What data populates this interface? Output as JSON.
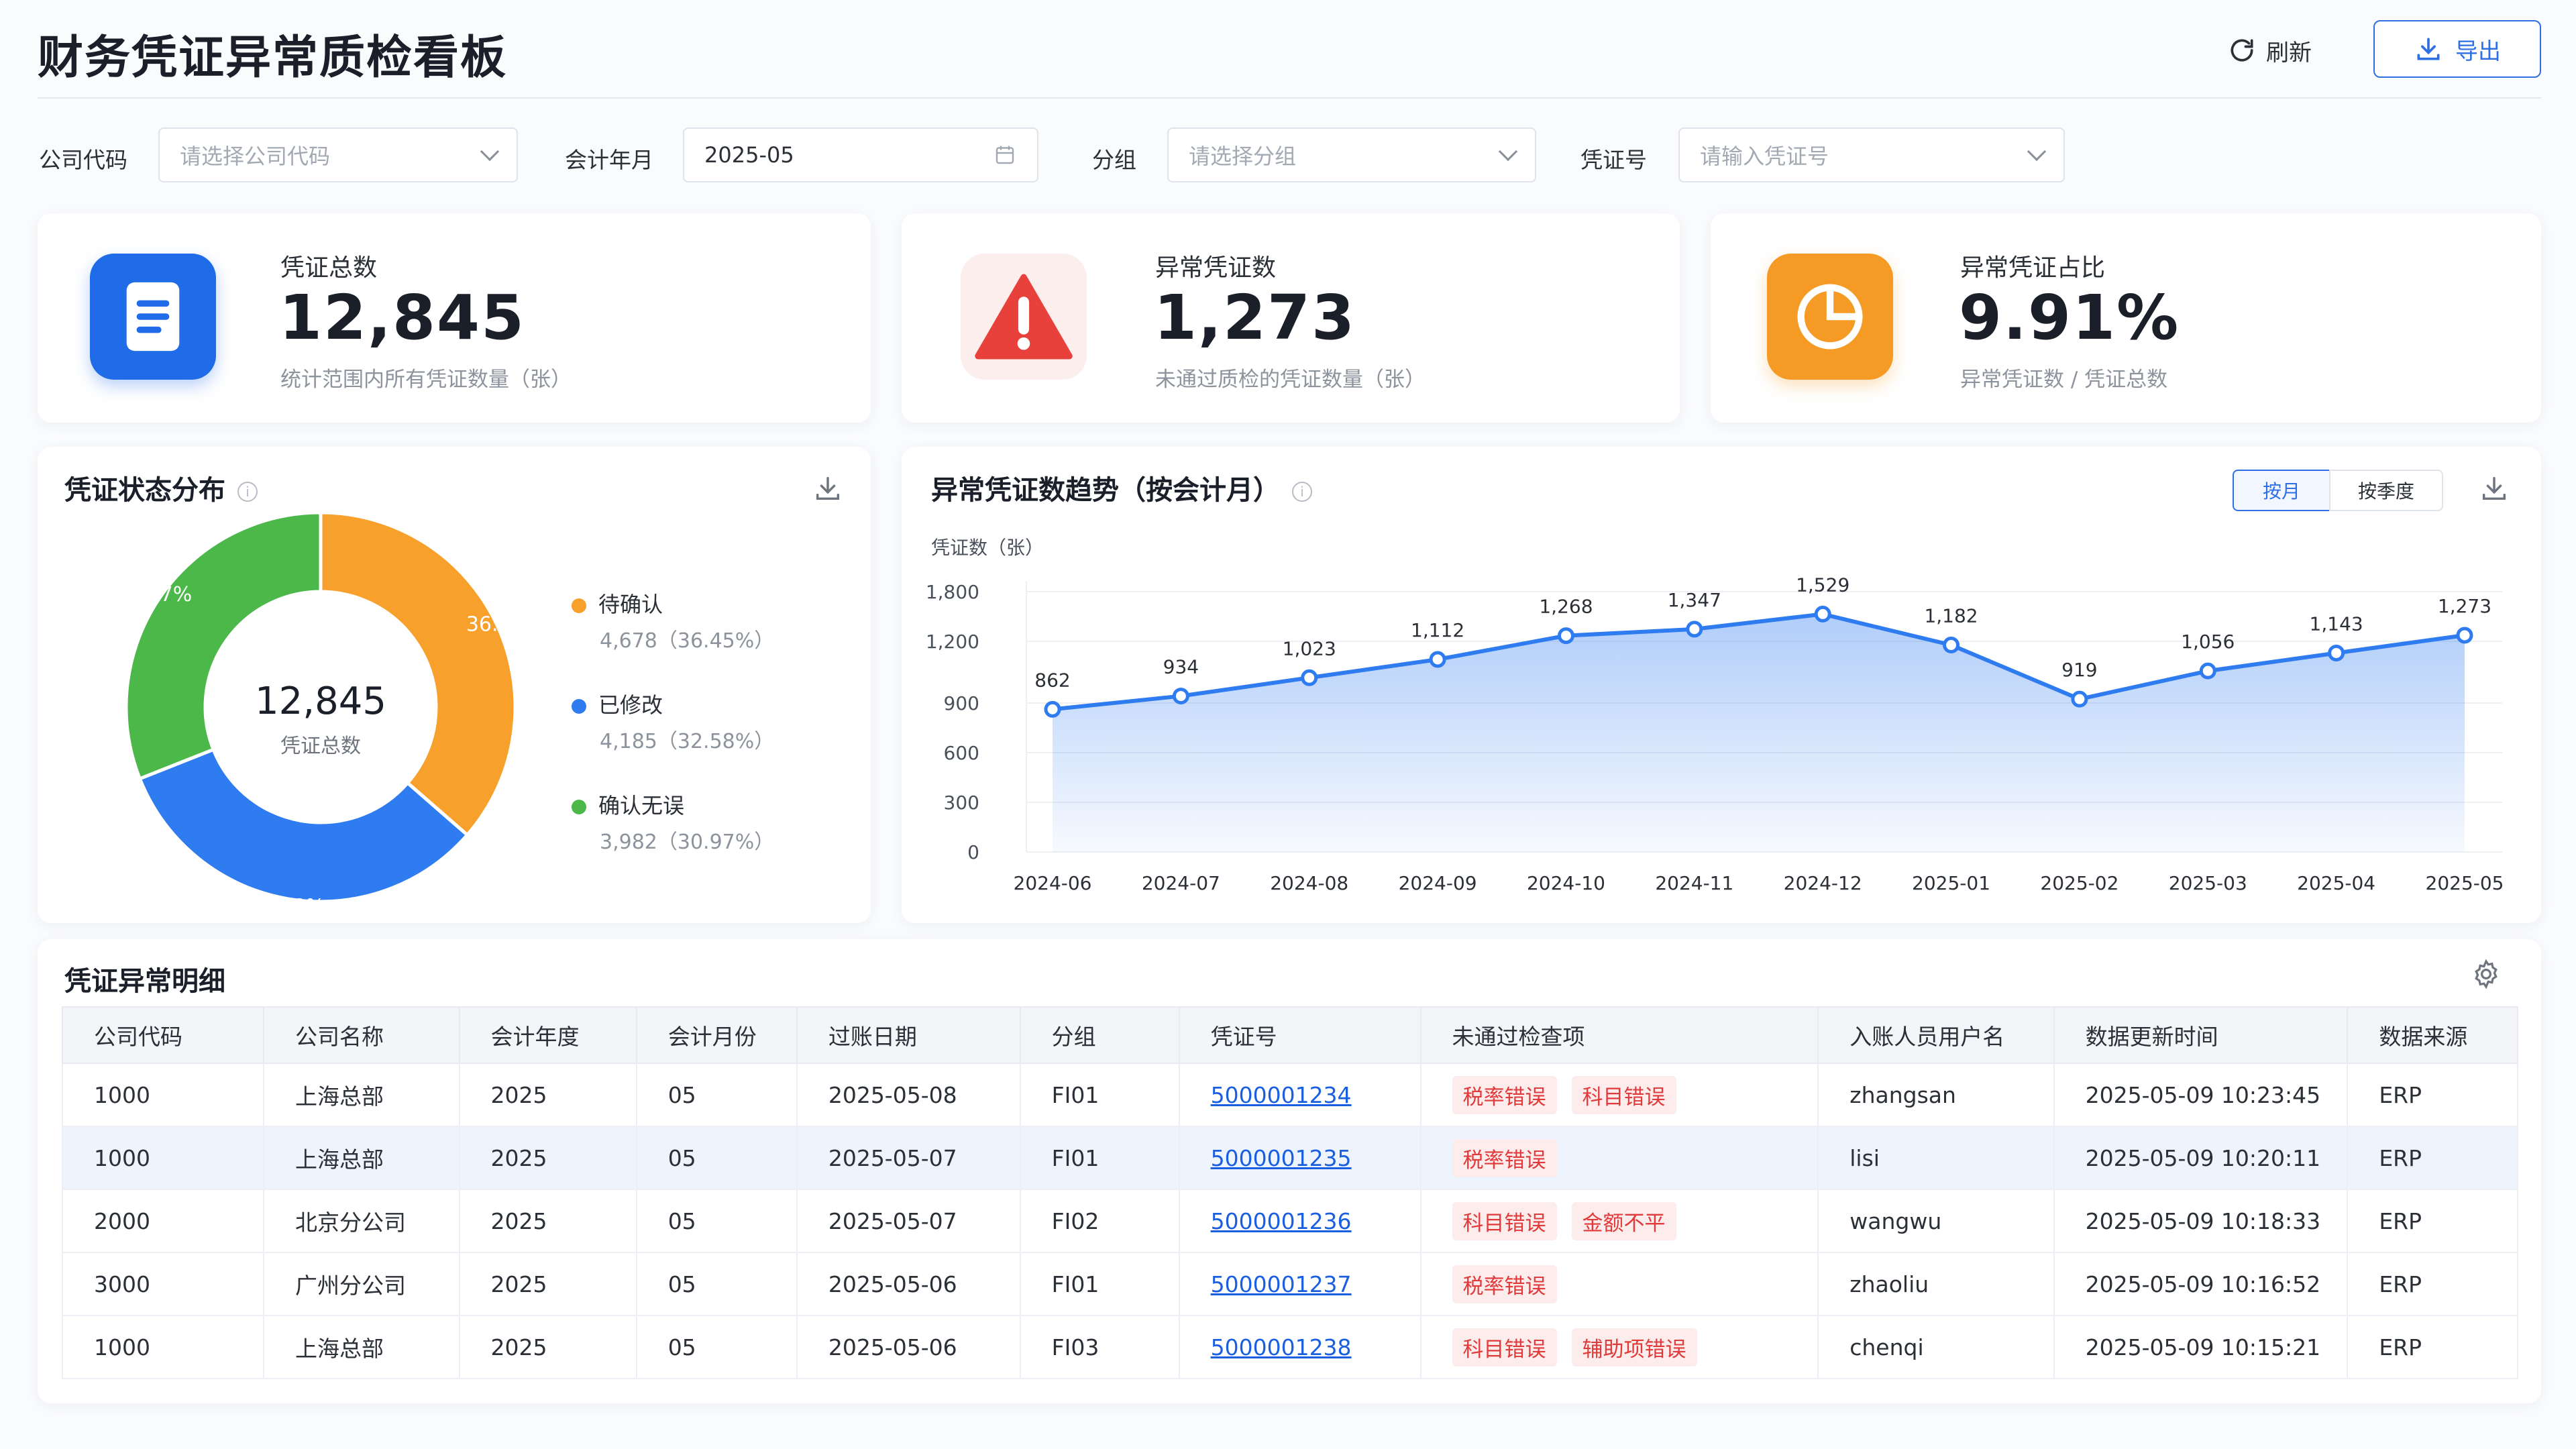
{
  "header": {
    "title": "财务凭证异常质检看板",
    "refresh_label": "刷新",
    "export_label": "导出"
  },
  "filters": {
    "company_code": {
      "label": "公司代码",
      "placeholder": "请选择公司代码"
    },
    "period": {
      "label": "会计年月",
      "value": "2025-05"
    },
    "group": {
      "label": "分组",
      "placeholder": "请选择分组"
    },
    "voucher_no": {
      "label": "凭证号",
      "placeholder": "请输入凭证号"
    }
  },
  "kpis": [
    {
      "label": "凭证总数",
      "value": "12,845",
      "sub": "统计范围内所有凭证数量（张）",
      "color": "#1f6be8"
    },
    {
      "label": "异常凭证数",
      "value": "1,273",
      "sub": "未通过质检的凭证数量（张）",
      "color": "#e8403a"
    },
    {
      "label": "异常凭证占比",
      "value": "9.91%",
      "sub": "异常凭证数 / 凭证总数",
      "color": "#f59a24"
    }
  ],
  "status_panel": {
    "title": "凭证状态分布",
    "center_value": "12,845",
    "center_label": "凭证总数"
  },
  "trend_panel": {
    "title": "异常凭证数趋势（按会计月）",
    "toggle_month": "按月",
    "toggle_quarter": "按季度",
    "ylabel": "凭证数（张）"
  },
  "chart_data": [
    {
      "type": "pie",
      "slices": [
        {
          "name": "待确认",
          "value": 4678,
          "percent": "36.45%",
          "detail": "4,678（36.45%）",
          "color": "#f8a02c"
        },
        {
          "name": "已修改",
          "value": 4185,
          "percent": "32.58%",
          "detail": "4,185（32.58%）",
          "color": "#2f7bf0"
        },
        {
          "name": "确认无误",
          "value": 3982,
          "percent": "30.97%",
          "detail": "3,982（30.97%）",
          "color": "#4cb84a"
        }
      ]
    },
    {
      "type": "area",
      "x": [
        "2024-06",
        "2024-07",
        "2024-08",
        "2024-09",
        "2024-10",
        "2024-11",
        "2024-12",
        "2025-01",
        "2025-02",
        "2025-03",
        "2025-04",
        "2025-05"
      ],
      "values": [
        862,
        934,
        1023,
        1112,
        1268,
        1347,
        1529,
        1182,
        919,
        1056,
        1143,
        1273
      ],
      "value_labels": [
        "862",
        "934",
        "1,023",
        "1,112",
        "1,268",
        "1,347",
        "1,529",
        "1,182",
        "919",
        "1,056",
        "1,143",
        "1,273"
      ],
      "yticks": [
        "0",
        "300",
        "600",
        "900",
        "1,200",
        "1,800"
      ],
      "ylabel": "凭证数（张）",
      "color": "#2f7bf0"
    }
  ],
  "detail": {
    "title": "凭证异常明细",
    "columns": [
      "公司代码",
      "公司名称",
      "会计年度",
      "会计月份",
      "过账日期",
      "分组",
      "凭证号",
      "未通过检查项",
      "入账人员用户名",
      "数据更新时间",
      "数据来源"
    ],
    "rows": [
      {
        "code": "1000",
        "name": "上海总部",
        "year": "2025",
        "month": "05",
        "date": "2025-05-08",
        "group": "FI01",
        "voucher": "5000001234",
        "tags": [
          "税率错误",
          "科目错误"
        ],
        "user": "zhangsan",
        "updated": "2025-05-09 10:23:45",
        "source": "ERP"
      },
      {
        "code": "1000",
        "name": "上海总部",
        "year": "2025",
        "month": "05",
        "date": "2025-05-07",
        "group": "FI01",
        "voucher": "5000001235",
        "tags": [
          "税率错误"
        ],
        "user": "lisi",
        "updated": "2025-05-09 10:20:11",
        "source": "ERP"
      },
      {
        "code": "2000",
        "name": "北京分公司",
        "year": "2025",
        "month": "05",
        "date": "2025-05-07",
        "group": "FI02",
        "voucher": "5000001236",
        "tags": [
          "科目错误",
          "金额不平"
        ],
        "user": "wangwu",
        "updated": "2025-05-09 10:18:33",
        "source": "ERP"
      },
      {
        "code": "3000",
        "name": "广州分公司",
        "year": "2025",
        "month": "05",
        "date": "2025-05-06",
        "group": "FI01",
        "voucher": "5000001237",
        "tags": [
          "税率错误"
        ],
        "user": "zhaoliu",
        "updated": "2025-05-09 10:16:52",
        "source": "ERP"
      },
      {
        "code": "1000",
        "name": "上海总部",
        "year": "2025",
        "month": "05",
        "date": "2025-05-06",
        "group": "FI03",
        "voucher": "5000001238",
        "tags": [
          "科目错误",
          "辅助项错误"
        ],
        "user": "chenqi",
        "updated": "2025-05-09 10:15:21",
        "source": "ERP"
      }
    ]
  }
}
